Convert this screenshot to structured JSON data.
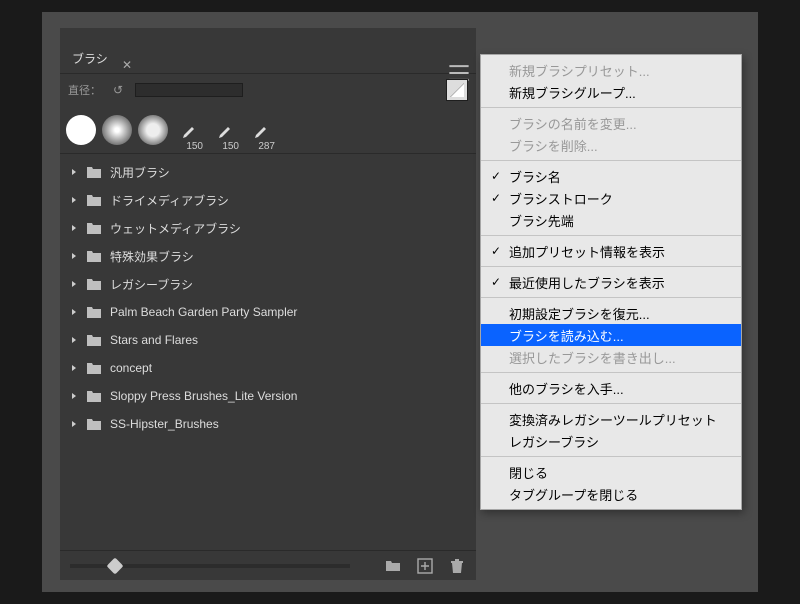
{
  "panel": {
    "tab_label": "ブラシ",
    "size_label": "直径：",
    "recent_brushes": [
      {
        "kind": "solid",
        "label": ""
      },
      {
        "kind": "soft",
        "label": ""
      },
      {
        "kind": "med",
        "label": ""
      },
      {
        "kind": "pen",
        "label": "150"
      },
      {
        "kind": "pen",
        "label": "150"
      },
      {
        "kind": "pen",
        "label": "287"
      }
    ],
    "folders": [
      "汎用ブラシ",
      "ドライメディアブラシ",
      "ウェットメディアブラシ",
      "特殊効果ブラシ",
      "レガシーブラシ",
      "Palm Beach Garden Party Sampler",
      "Stars and Flares",
      "concept",
      "Sloppy Press Brushes_Lite Version",
      "SS-Hipster_Brushes"
    ]
  },
  "menu": {
    "items": [
      {
        "label": "新規ブラシプリセット...",
        "type": "disabled"
      },
      {
        "label": "新規ブラシグループ...",
        "type": "item"
      },
      {
        "type": "sep"
      },
      {
        "label": "ブラシの名前を変更...",
        "type": "disabled"
      },
      {
        "label": "ブラシを削除...",
        "type": "disabled"
      },
      {
        "type": "sep"
      },
      {
        "label": "ブラシ名",
        "type": "check"
      },
      {
        "label": "ブラシストローク",
        "type": "check"
      },
      {
        "label": "ブラシ先端",
        "type": "item"
      },
      {
        "type": "sep"
      },
      {
        "label": "追加プリセット情報を表示",
        "type": "check"
      },
      {
        "type": "sep"
      },
      {
        "label": "最近使用したブラシを表示",
        "type": "check"
      },
      {
        "type": "sep"
      },
      {
        "label": "初期設定ブラシを復元...",
        "type": "item"
      },
      {
        "label": "ブラシを読み込む...",
        "type": "highlight"
      },
      {
        "label": "選択したブラシを書き出し...",
        "type": "disabled"
      },
      {
        "type": "sep"
      },
      {
        "label": "他のブラシを入手...",
        "type": "item"
      },
      {
        "type": "sep"
      },
      {
        "label": "変換済みレガシーツールプリセット",
        "type": "item"
      },
      {
        "label": "レガシーブラシ",
        "type": "item"
      },
      {
        "type": "sep"
      },
      {
        "label": "閉じる",
        "type": "item"
      },
      {
        "label": "タブグループを閉じる",
        "type": "item"
      }
    ]
  }
}
